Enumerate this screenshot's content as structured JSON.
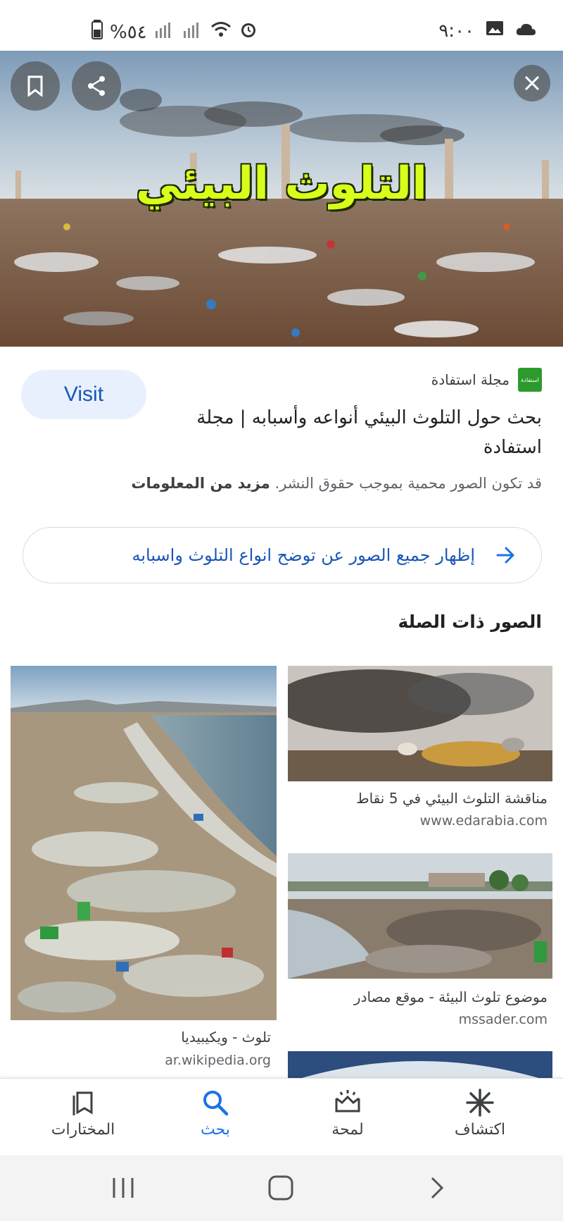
{
  "status_bar": {
    "time": "٩:٠٠",
    "battery": "%٥٤"
  },
  "hero": {
    "title": "التلوث البيئي"
  },
  "result": {
    "visit_label": "Visit",
    "source_name": "مجلة استفادة",
    "source_logo_text": "استفادة",
    "title": "بحث حول التلوث البيئي أنواعه وأسبابه | مجلة استفادة",
    "copyright_text": "قد تكون الصور محمية بموجب حقوق النشر.",
    "more_info": "مزيد من المعلومات"
  },
  "show_all": {
    "label": "إظهار جميع الصور عن توضح انواع التلوث واسبابه"
  },
  "related": {
    "heading": "الصور ذات الصلة",
    "items": [
      {
        "caption": "مناقشة التلوث البيئي في 5 نقاط",
        "source": "www.edarabia.com"
      },
      {
        "caption": "موضوع تلوث البيئة - موقع مصادر",
        "source": "mssader.com"
      },
      {
        "caption": "تلوث - ويكيبيديا",
        "source": "ar.wikipedia.org"
      }
    ]
  },
  "bottom_nav": {
    "items": [
      {
        "label": "المختارات",
        "icon": "bookmarks-icon"
      },
      {
        "label": "بحث",
        "icon": "search-icon",
        "active": true
      },
      {
        "label": "لمحة",
        "icon": "snapshot-icon"
      },
      {
        "label": "اكتشاف",
        "icon": "discover-icon"
      }
    ]
  },
  "colors": {
    "accent": "#1a73e8",
    "link": "#1a56b7",
    "visit_bg": "#e8f0fe",
    "hero_title": "#d8ff1a"
  }
}
